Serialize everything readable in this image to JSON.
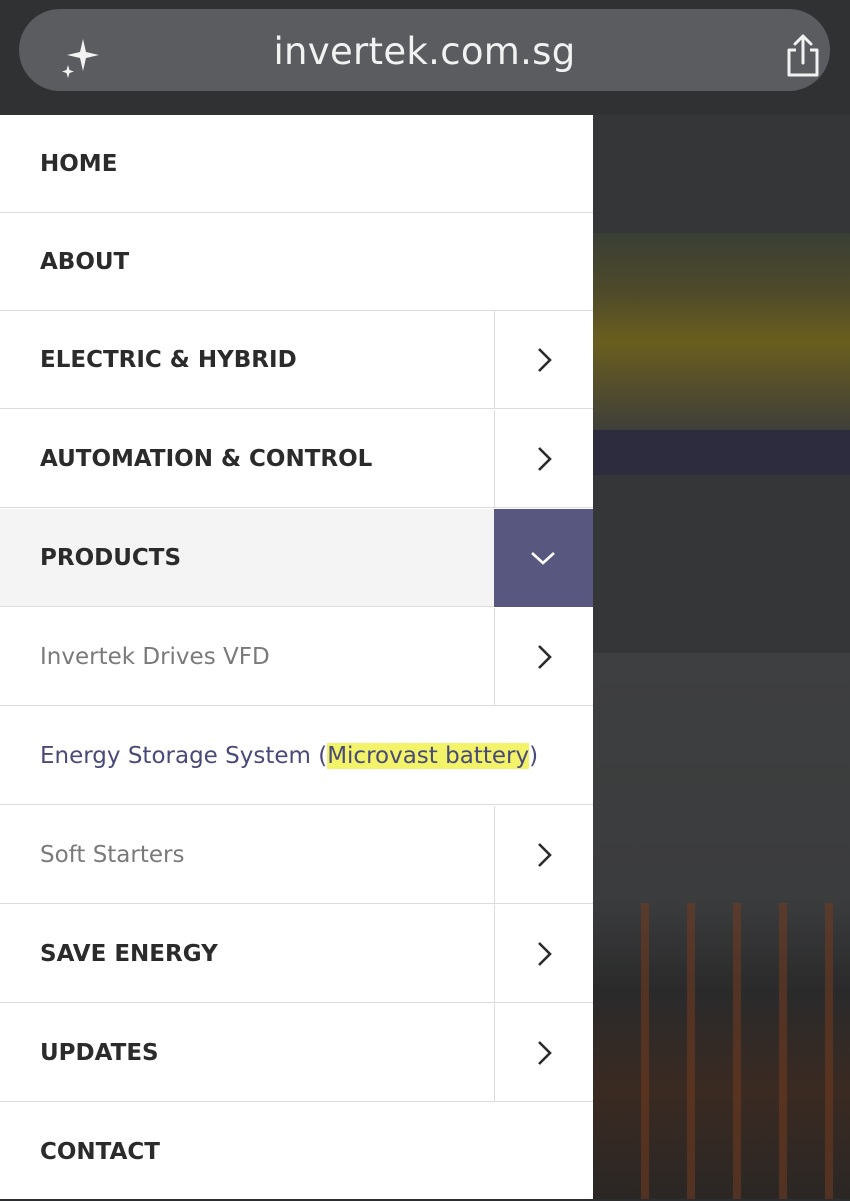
{
  "browser": {
    "url": "invertek.com.sg"
  },
  "menu": {
    "items": [
      {
        "label": "HOME"
      },
      {
        "label": "ABOUT"
      },
      {
        "label": "ELECTRIC & HYBRID"
      },
      {
        "label": "AUTOMATION & CONTROL"
      },
      {
        "label": "PRODUCTS"
      },
      {
        "label": "Invertek Drives VFD"
      },
      {
        "label_before": "Energy Storage System (",
        "label_highlight": "Microvast battery",
        "label_after": ")"
      },
      {
        "label": "Soft Starters"
      },
      {
        "label": "SAVE ENERGY"
      },
      {
        "label": "UPDATES"
      },
      {
        "label": "CONTACT"
      }
    ]
  },
  "colors": {
    "accent": "#58577f",
    "highlight": "#f3f36a"
  }
}
